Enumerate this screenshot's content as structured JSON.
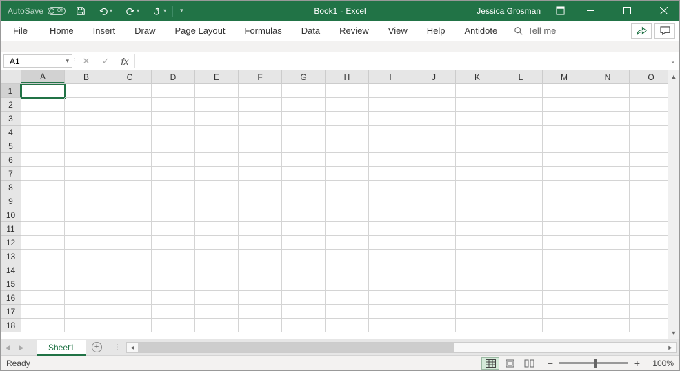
{
  "titlebar": {
    "autosave_label": "AutoSave",
    "autosave_state": "Off",
    "doc_name": "Book1",
    "app_name": "Excel",
    "username": "Jessica Grosman"
  },
  "ribbon": {
    "tabs": [
      "File",
      "Home",
      "Insert",
      "Draw",
      "Page Layout",
      "Formulas",
      "Data",
      "Review",
      "View",
      "Help",
      "Antidote"
    ],
    "tell_me": "Tell me"
  },
  "name_box": {
    "value": "A1"
  },
  "formula_bar": {
    "value": ""
  },
  "grid": {
    "columns": [
      "A",
      "B",
      "C",
      "D",
      "E",
      "F",
      "G",
      "H",
      "I",
      "J",
      "K",
      "L",
      "M",
      "N",
      "O"
    ],
    "rows": [
      "1",
      "2",
      "3",
      "4",
      "5",
      "6",
      "7",
      "8",
      "9",
      "10",
      "11",
      "12",
      "13",
      "14",
      "15",
      "16",
      "17",
      "18"
    ],
    "active_cell": "A1"
  },
  "sheets": {
    "active": "Sheet1"
  },
  "status": {
    "mode": "Ready",
    "zoom": "100%"
  }
}
